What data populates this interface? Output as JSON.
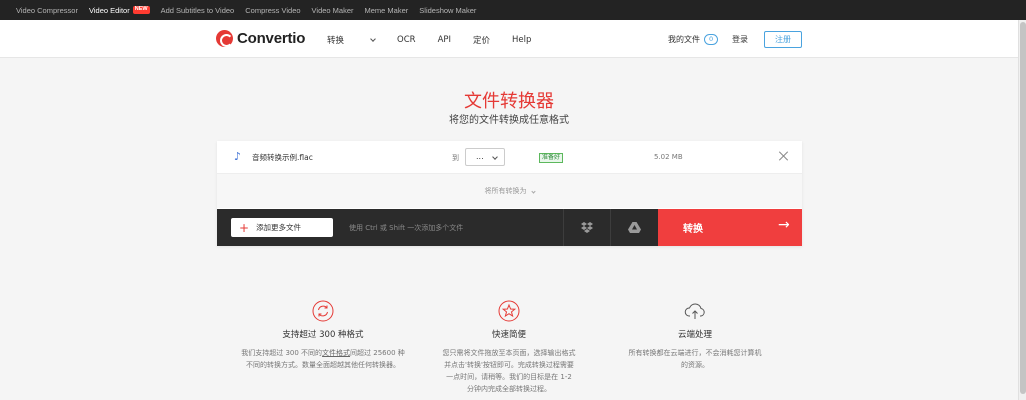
{
  "topbar": {
    "links": [
      "Video Compressor",
      "Video Editor",
      "Add Subtitles to Video",
      "Compress Video",
      "Video Maker",
      "Meme Maker",
      "Slideshow Maker"
    ],
    "new_badge": "NEW"
  },
  "header": {
    "logo": "Convertio",
    "nav": [
      "转换",
      "OCR",
      "API",
      "定价",
      "Help"
    ],
    "my_files": "我的文件",
    "my_files_count": "0",
    "login": "登录",
    "signup": "注册"
  },
  "hero": {
    "title": "文件转换器",
    "subtitle": "将您的文件转换成任意格式"
  },
  "file": {
    "name": "音频转换示例.flac",
    "to_label": "到",
    "format_value": "...",
    "status": "准备好",
    "size": "5.02 MB"
  },
  "convert_all": "将所有转换为",
  "actionbar": {
    "add_files": "添加更多文件",
    "hint": "使用 Ctrl 或 Shift 一次添加多个文件",
    "convert": "转换"
  },
  "features": [
    {
      "title": "支持超过 300 种格式",
      "desc_pre": "我们支持超过 300 不同的",
      "desc_link": "文件格式",
      "desc_post": "间超过 25600 种不同的转换方式。数量全面超越其他任何转换器。"
    },
    {
      "title": "快速简便",
      "desc": "您只需将文件拖放至本页面，选择输出格式并点击'转换'按钮即可。完成转换过程需要一点时间，请稍等。我们的目标是在 1-2 分钟内完成全部转换过程。"
    },
    {
      "title": "云端处理",
      "desc": "所有转换都在云端进行，不会消耗您计算机的资源。"
    }
  ],
  "colors": {
    "brand": "#e53935",
    "accent": "#4aa3df",
    "convert": "#f03e3e"
  }
}
